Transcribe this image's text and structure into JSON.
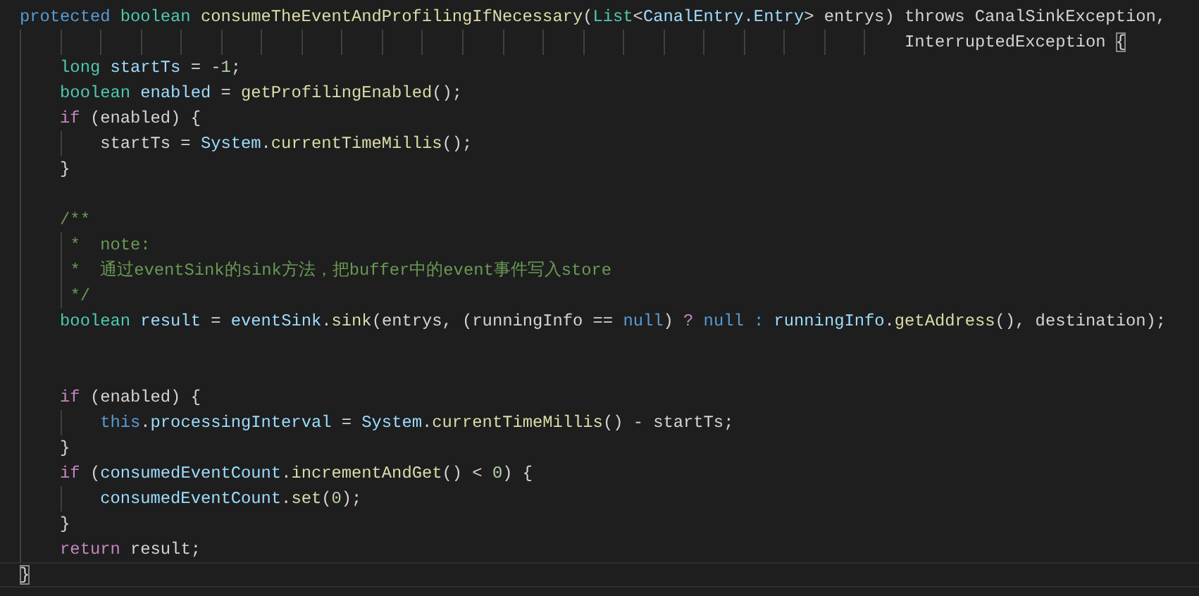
{
  "editor": {
    "lines": [
      {
        "tokens": [
          {
            "text": "protected ",
            "kind": "keyword"
          },
          {
            "text": "boolean ",
            "kind": "type"
          },
          {
            "text": "consumeTheEventAndProfilingIfNecessary",
            "kind": "function"
          },
          {
            "text": "(",
            "kind": "plain"
          },
          {
            "text": "List",
            "kind": "type"
          },
          {
            "text": "<",
            "kind": "plain"
          },
          {
            "text": "CanalEntry.Entry",
            "kind": "variable"
          },
          {
            "text": "> entrys) throws CanalSinkException,",
            "kind": "plain"
          }
        ]
      },
      {
        "tokens": [
          {
            "text": "                                                                                        InterruptedException ",
            "kind": "plain"
          },
          {
            "text": "{",
            "kind": "plain",
            "matched": true
          }
        ]
      },
      {
        "tokens": [
          {
            "text": "    long ",
            "kind": "type"
          },
          {
            "text": "startTs",
            "kind": "variable"
          },
          {
            "text": " = -",
            "kind": "plain"
          },
          {
            "text": "1",
            "kind": "number"
          },
          {
            "text": ";",
            "kind": "plain"
          }
        ]
      },
      {
        "tokens": [
          {
            "text": "    boolean ",
            "kind": "type"
          },
          {
            "text": "enabled",
            "kind": "variable"
          },
          {
            "text": " = ",
            "kind": "plain"
          },
          {
            "text": "getProfilingEnabled",
            "kind": "function"
          },
          {
            "text": "();",
            "kind": "plain"
          }
        ]
      },
      {
        "tokens": [
          {
            "text": "    if",
            "kind": "control"
          },
          {
            "text": " (enabled) {",
            "kind": "plain"
          }
        ]
      },
      {
        "tokens": [
          {
            "text": "        startTs = ",
            "kind": "plain"
          },
          {
            "text": "System",
            "kind": "variable"
          },
          {
            "text": ".",
            "kind": "plain"
          },
          {
            "text": "currentTimeMillis",
            "kind": "function"
          },
          {
            "text": "();",
            "kind": "plain"
          }
        ]
      },
      {
        "tokens": [
          {
            "text": "    }",
            "kind": "plain"
          }
        ]
      },
      {
        "kind": "blank"
      },
      {
        "tokens": [
          {
            "text": "    /**",
            "kind": "comment"
          }
        ]
      },
      {
        "tokens": [
          {
            "text": "     *  note:",
            "kind": "comment"
          }
        ]
      },
      {
        "tokens": [
          {
            "text": "     *  通过eventSink的sink方法，把buffer中的event事件写入store",
            "kind": "comment"
          }
        ]
      },
      {
        "tokens": [
          {
            "text": "     */",
            "kind": "comment"
          }
        ]
      },
      {
        "tokens": [
          {
            "text": "    boolean ",
            "kind": "type"
          },
          {
            "text": "result",
            "kind": "variable"
          },
          {
            "text": " = ",
            "kind": "plain"
          },
          {
            "text": "eventSink",
            "kind": "variable"
          },
          {
            "text": ".",
            "kind": "plain"
          },
          {
            "text": "sink",
            "kind": "function"
          },
          {
            "text": "(entrys, (runningInfo == ",
            "kind": "plain"
          },
          {
            "text": "null",
            "kind": "keyword"
          },
          {
            "text": ") ",
            "kind": "plain"
          },
          {
            "text": "?",
            "kind": "control"
          },
          {
            "text": " null : ",
            "kind": "keyword"
          },
          {
            "text": "runningInfo",
            "kind": "variable"
          },
          {
            "text": ".",
            "kind": "plain"
          },
          {
            "text": "getAddress",
            "kind": "function"
          },
          {
            "text": "(), destination);",
            "kind": "plain"
          }
        ]
      },
      {
        "kind": "blank"
      },
      {
        "kind": "blank"
      },
      {
        "tokens": [
          {
            "text": "    if",
            "kind": "control"
          },
          {
            "text": " (enabled) {",
            "kind": "plain"
          }
        ]
      },
      {
        "tokens": [
          {
            "text": "        this",
            "kind": "keyword"
          },
          {
            "text": ".",
            "kind": "plain"
          },
          {
            "text": "processingInterval",
            "kind": "variable"
          },
          {
            "text": " = ",
            "kind": "plain"
          },
          {
            "text": "System",
            "kind": "variable"
          },
          {
            "text": ".",
            "kind": "plain"
          },
          {
            "text": "currentTimeMillis",
            "kind": "function"
          },
          {
            "text": "() - startTs;",
            "kind": "plain"
          }
        ]
      },
      {
        "tokens": [
          {
            "text": "    }",
            "kind": "plain"
          }
        ]
      },
      {
        "tokens": [
          {
            "text": "    if",
            "kind": "control"
          },
          {
            "text": " (",
            "kind": "plain"
          },
          {
            "text": "consumedEventCount",
            "kind": "variable"
          },
          {
            "text": ".",
            "kind": "plain"
          },
          {
            "text": "incrementAndGet",
            "kind": "function"
          },
          {
            "text": "() < ",
            "kind": "plain"
          },
          {
            "text": "0",
            "kind": "number"
          },
          {
            "text": ") {",
            "kind": "plain"
          }
        ]
      },
      {
        "tokens": [
          {
            "text": "        consumedEventCount",
            "kind": "variable"
          },
          {
            "text": ".",
            "kind": "plain"
          },
          {
            "text": "set",
            "kind": "function"
          },
          {
            "text": "(",
            "kind": "plain"
          },
          {
            "text": "0",
            "kind": "number"
          },
          {
            "text": ");",
            "kind": "plain"
          }
        ]
      },
      {
        "tokens": [
          {
            "text": "    }",
            "kind": "plain"
          }
        ]
      },
      {
        "tokens": [
          {
            "text": "    return",
            "kind": "control"
          },
          {
            "text": " result;",
            "kind": "plain"
          }
        ]
      },
      {
        "current": true,
        "tokens": [
          {
            "text": "}",
            "kind": "plain",
            "matched": true
          }
        ]
      }
    ]
  }
}
